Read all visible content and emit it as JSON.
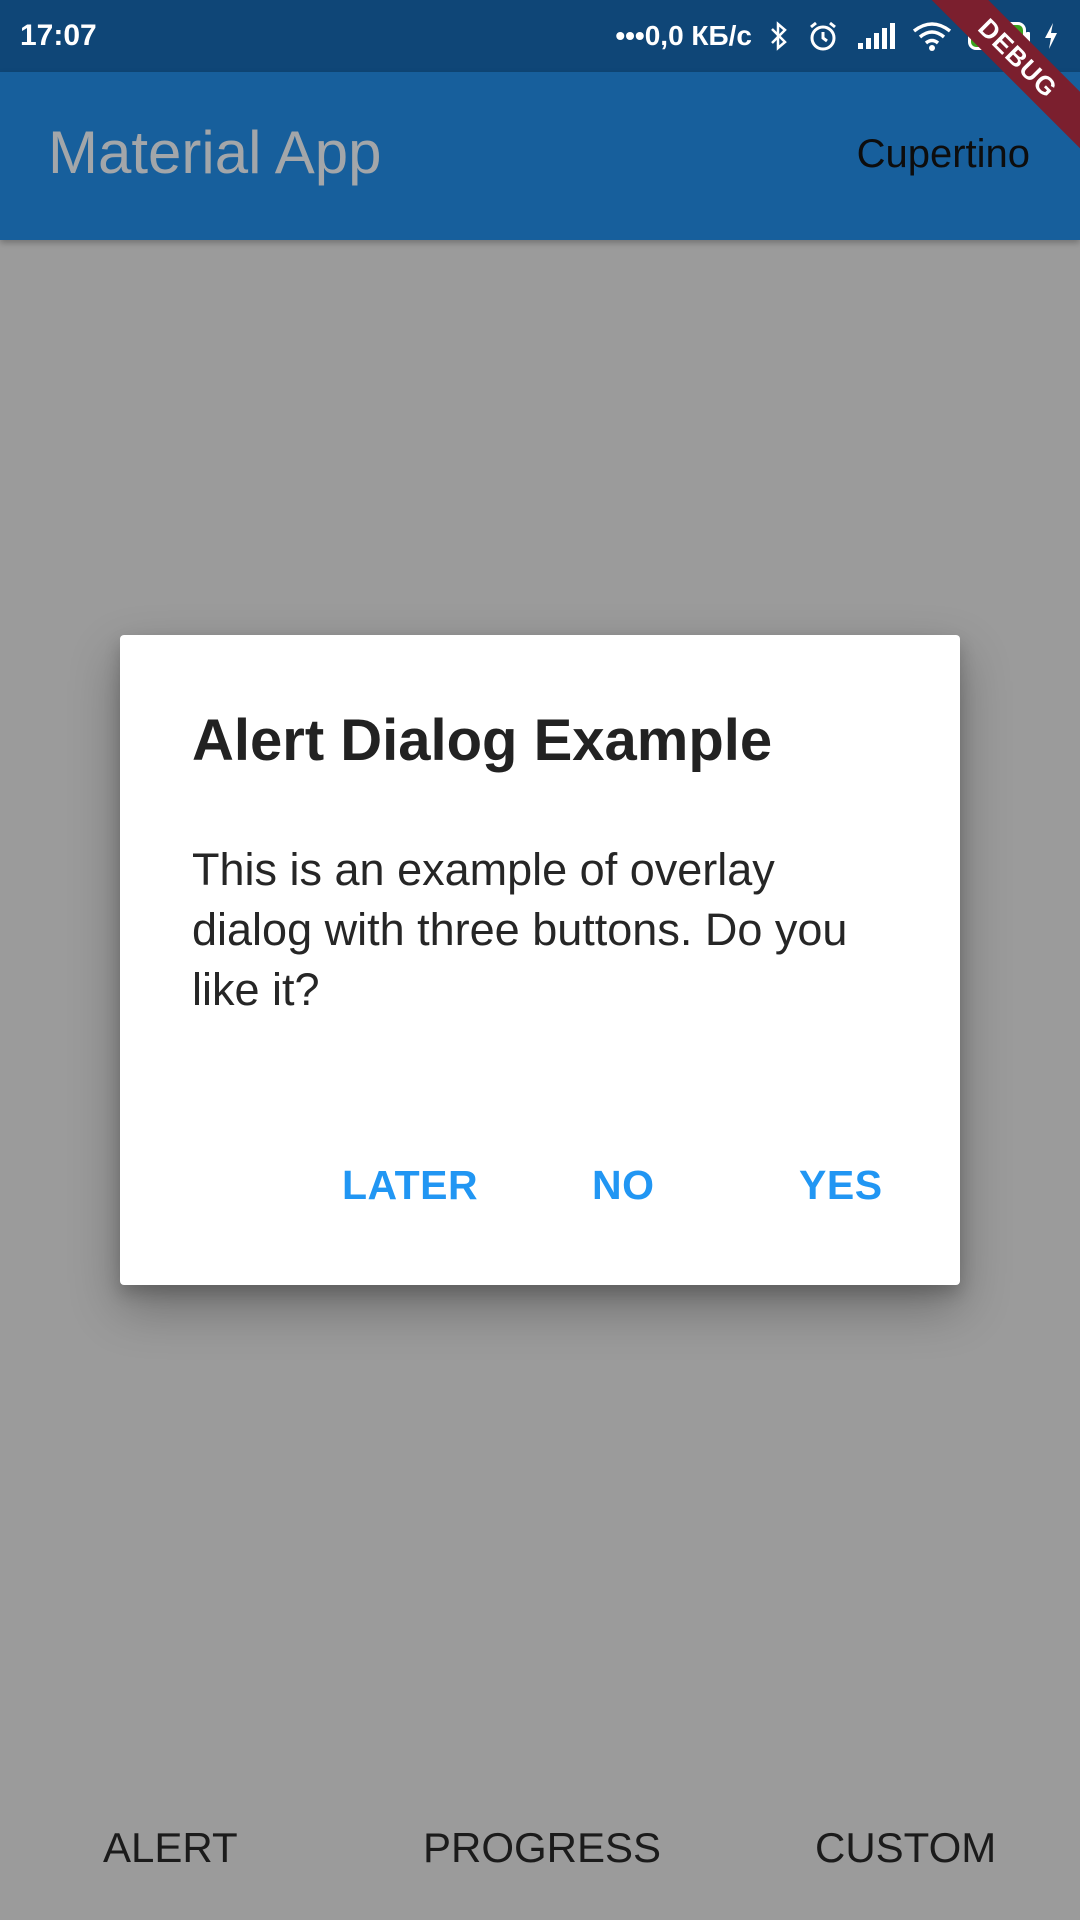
{
  "status_bar": {
    "time": "17:07",
    "network_speed": "•••0,0 КБ/с",
    "battery_level": "100",
    "icons": [
      "bluetooth-icon",
      "alarm-icon",
      "signal-icon",
      "wifi-icon",
      "battery-icon",
      "charging-icon"
    ]
  },
  "app_bar": {
    "title": "Material App",
    "action_label": "Cupertino"
  },
  "debug_banner": "DEBUG",
  "dialog": {
    "title": "Alert Dialog Example",
    "content": "This is an example of overlay dialog with three buttons. Do you like it?",
    "buttons": {
      "later": "LATER",
      "no": "NO",
      "yes": "YES"
    }
  },
  "bottom_nav": {
    "alert": "ALERT",
    "progress": "PROGRESS",
    "custom": "CUSTOM"
  },
  "colors": {
    "status_bar": "#0f4677",
    "app_bar": "#175f9c",
    "scrim_background": "#9b9b9b",
    "dialog_button": "#2196f3",
    "debug_ribbon": "#7b1f2e",
    "battery_fill": "#3aa11c"
  }
}
